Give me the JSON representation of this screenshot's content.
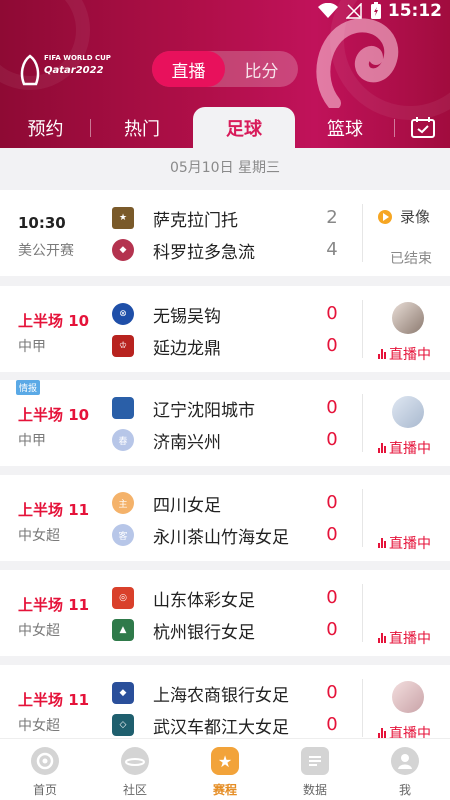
{
  "status": {
    "time": "15:12"
  },
  "header": {
    "logo_line1": "FIFA WORLD CUP",
    "logo_line2": "Qatar2022",
    "segments": [
      "直播",
      "比分"
    ],
    "tabs": [
      "预约",
      "热门",
      "足球",
      "篮球"
    ]
  },
  "date": "05月10日 星期三",
  "matches": [
    {
      "time": "10:30",
      "league": "美公开赛",
      "home": "萨克拉门托",
      "away": "科罗拉多急流",
      "home_score": "2",
      "away_score": "4",
      "replay": "录像",
      "status": "已结束"
    },
    {
      "time": "上半场 10",
      "league": "中甲",
      "home": "无锡吴钩",
      "away": "延边龙鼎",
      "home_score": "0",
      "away_score": "0",
      "status": "直播中"
    },
    {
      "tag": "情报",
      "time": "上半场 10",
      "league": "中甲",
      "home": "辽宁沈阳城市",
      "away": "济南兴州",
      "home_score": "0",
      "away_score": "0",
      "status": "直播中",
      "home_badge_text": "",
      "away_badge_text": "春"
    },
    {
      "time": "上半场 11",
      "league": "中女超",
      "home": "四川女足",
      "away": "永川茶山竹海女足",
      "home_score": "0",
      "away_score": "0",
      "status": "直播中",
      "home_badge_text": "主",
      "away_badge_text": "客"
    },
    {
      "time": "上半场 11",
      "league": "中女超",
      "home": "山东体彩女足",
      "away": "杭州银行女足",
      "home_score": "0",
      "away_score": "0",
      "status": "直播中"
    },
    {
      "time": "上半场 11",
      "league": "中女超",
      "home": "上海农商银行女足",
      "away": "武汉车都江大女足",
      "home_score": "0",
      "away_score": "0",
      "status": "直播中"
    }
  ],
  "bottom_nav": [
    "首页",
    "社区",
    "赛程",
    "数据",
    "我"
  ],
  "colors": {
    "brand": "#c0125a",
    "live": "#e5133a",
    "active_nav": "#e58d24"
  }
}
